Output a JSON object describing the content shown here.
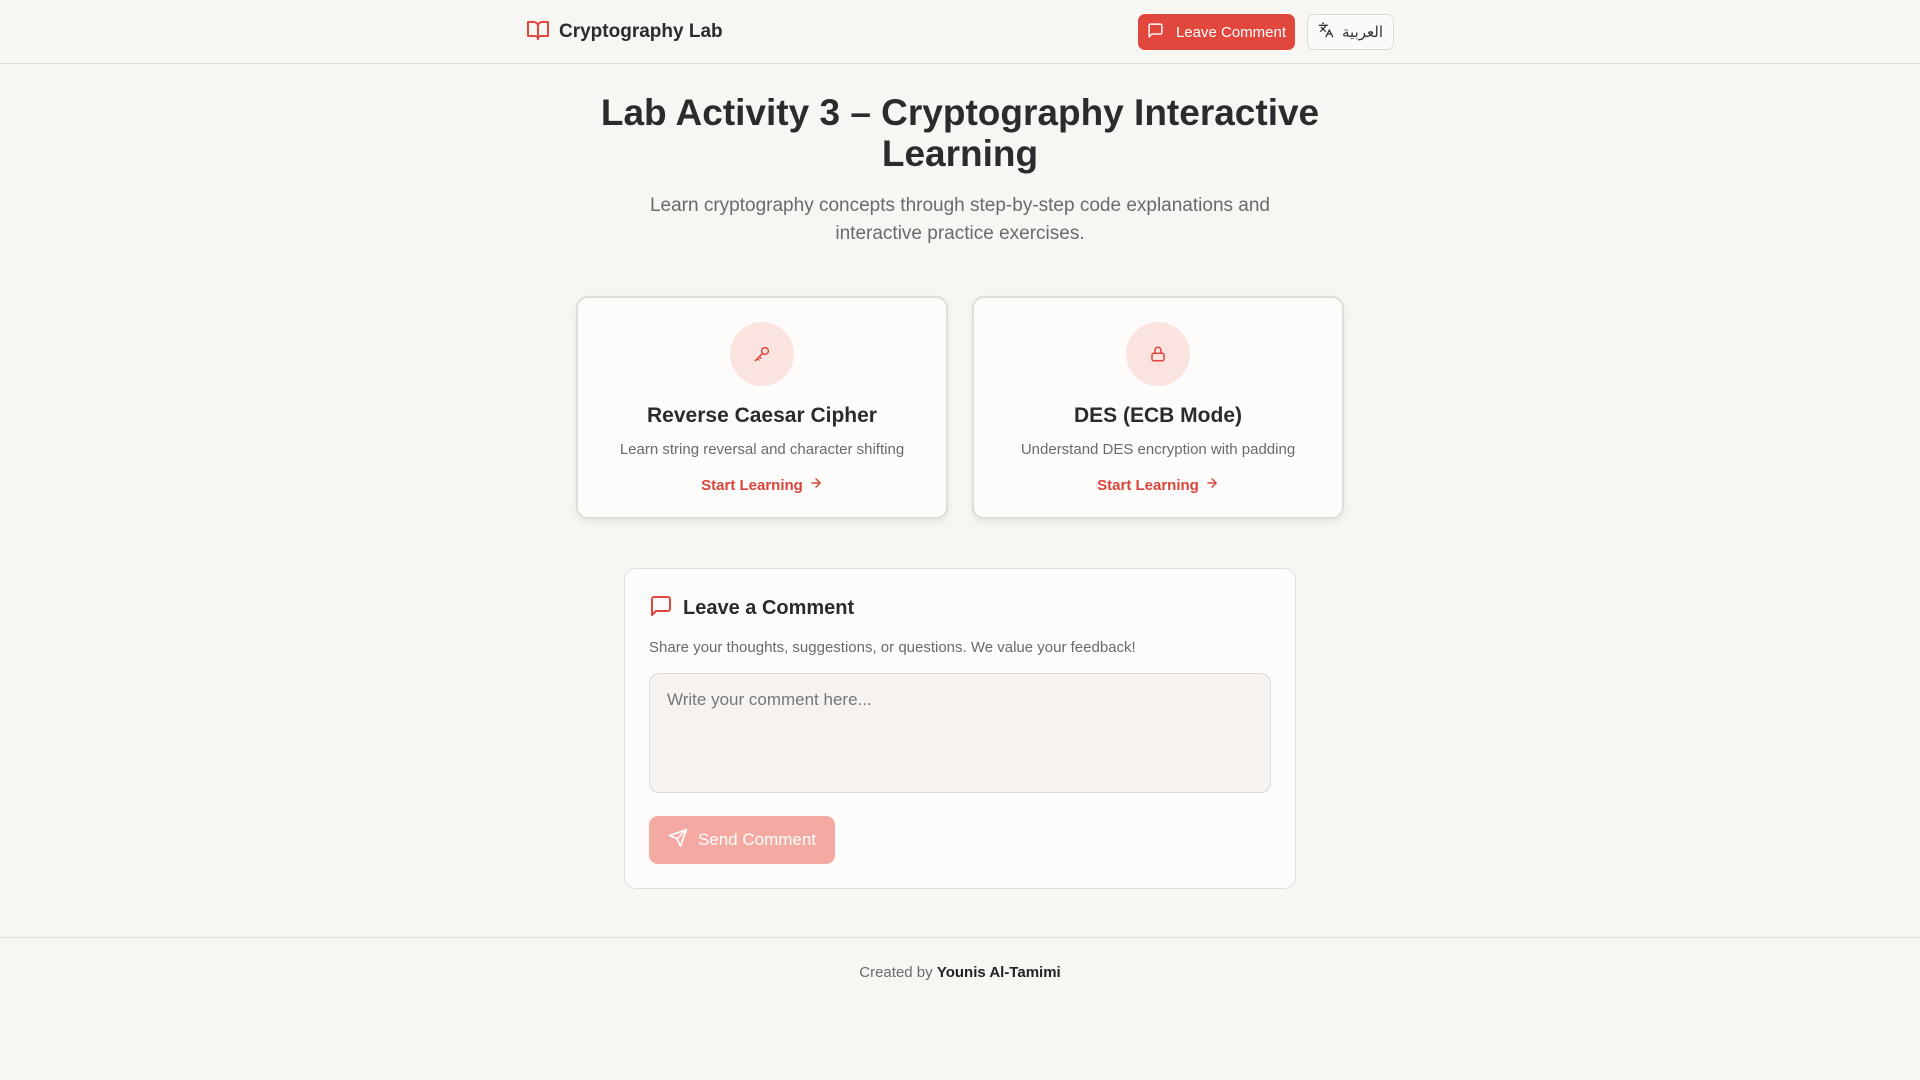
{
  "header": {
    "brand_icon": "book-open-icon",
    "brand_title": "Cryptography Lab",
    "comment_button_icon": "message-square-icon",
    "comment_button_label": "Leave Comment",
    "lang_button_icon": "languages-icon",
    "lang_button_label": "العربية"
  },
  "hero": {
    "title": "Lab Activity 3 – Cryptography Interactive Learning",
    "subtitle": "Learn cryptography concepts through step-by-step code explanations and interactive practice exercises."
  },
  "cards": [
    {
      "icon": "key-icon",
      "title": "Reverse Caesar Cipher",
      "description": "Learn string reversal and character shifting",
      "link": "Start Learning"
    },
    {
      "icon": "lock-icon",
      "title": "DES (ECB Mode)",
      "description": "Understand DES encryption with padding",
      "link": "Start Learning"
    }
  ],
  "comment": {
    "icon": "message-square-icon",
    "title": "Leave a Comment",
    "description": "Share your thoughts, suggestions, or questions. We value your feedback!",
    "placeholder": "Write your comment here...",
    "send_icon": "send-icon",
    "send_label": "Send Comment"
  },
  "footer": {
    "prefix": "Created by",
    "author": "Younis Al-Tamimi"
  },
  "colors": {
    "accent": "#e1473d",
    "accent_disabled": "#f4a9a2",
    "background": "#f8f6f3",
    "icon_circle": "#fbe3df"
  }
}
